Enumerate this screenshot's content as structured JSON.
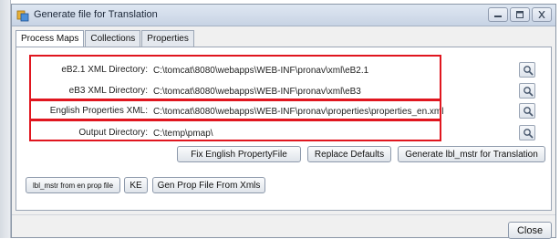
{
  "window": {
    "title": "Generate file for Translation"
  },
  "tabs": [
    {
      "label": "Process Maps",
      "active": true
    },
    {
      "label": "Collections",
      "active": false
    },
    {
      "label": "Properties",
      "active": false
    }
  ],
  "fields": [
    {
      "label": "eB2.1 XML Directory:",
      "value": "C:\\tomcat\\8080\\webapps\\WEB-INF\\pronav\\xml\\eB2.1"
    },
    {
      "label": "eB3 XML Directory:",
      "value": "C:\\tomcat\\8080\\webapps\\WEB-INF\\pronav\\xml\\eB3"
    },
    {
      "label": "English Properties XML:",
      "value": "C:\\tomcat\\8080\\webapps\\WEB-INF\\pronav\\properties\\properties_en.xml"
    },
    {
      "label": "Output Directory:",
      "value": "C:\\temp\\pmap\\"
    }
  ],
  "buttons": {
    "fix_english": "Fix English PropertyFile",
    "replace_defaults": "Replace Defaults",
    "generate_lbl_mstr": "Generate lbl_mstr for Translation",
    "lbl_mstr_from_en": "lbl_mstr from en prop file",
    "ke": "KE",
    "gen_prop_file": "Gen Prop File From Xmls",
    "close": "Close"
  },
  "icons": {
    "app": "translate-app-icon",
    "browse": "magnifier-icon",
    "minimize": "minimize-icon",
    "maximize": "maximize-icon",
    "close": "close-icon"
  },
  "colors": {
    "highlight": "#e0161f",
    "titlebar": "#c7d3e4"
  }
}
